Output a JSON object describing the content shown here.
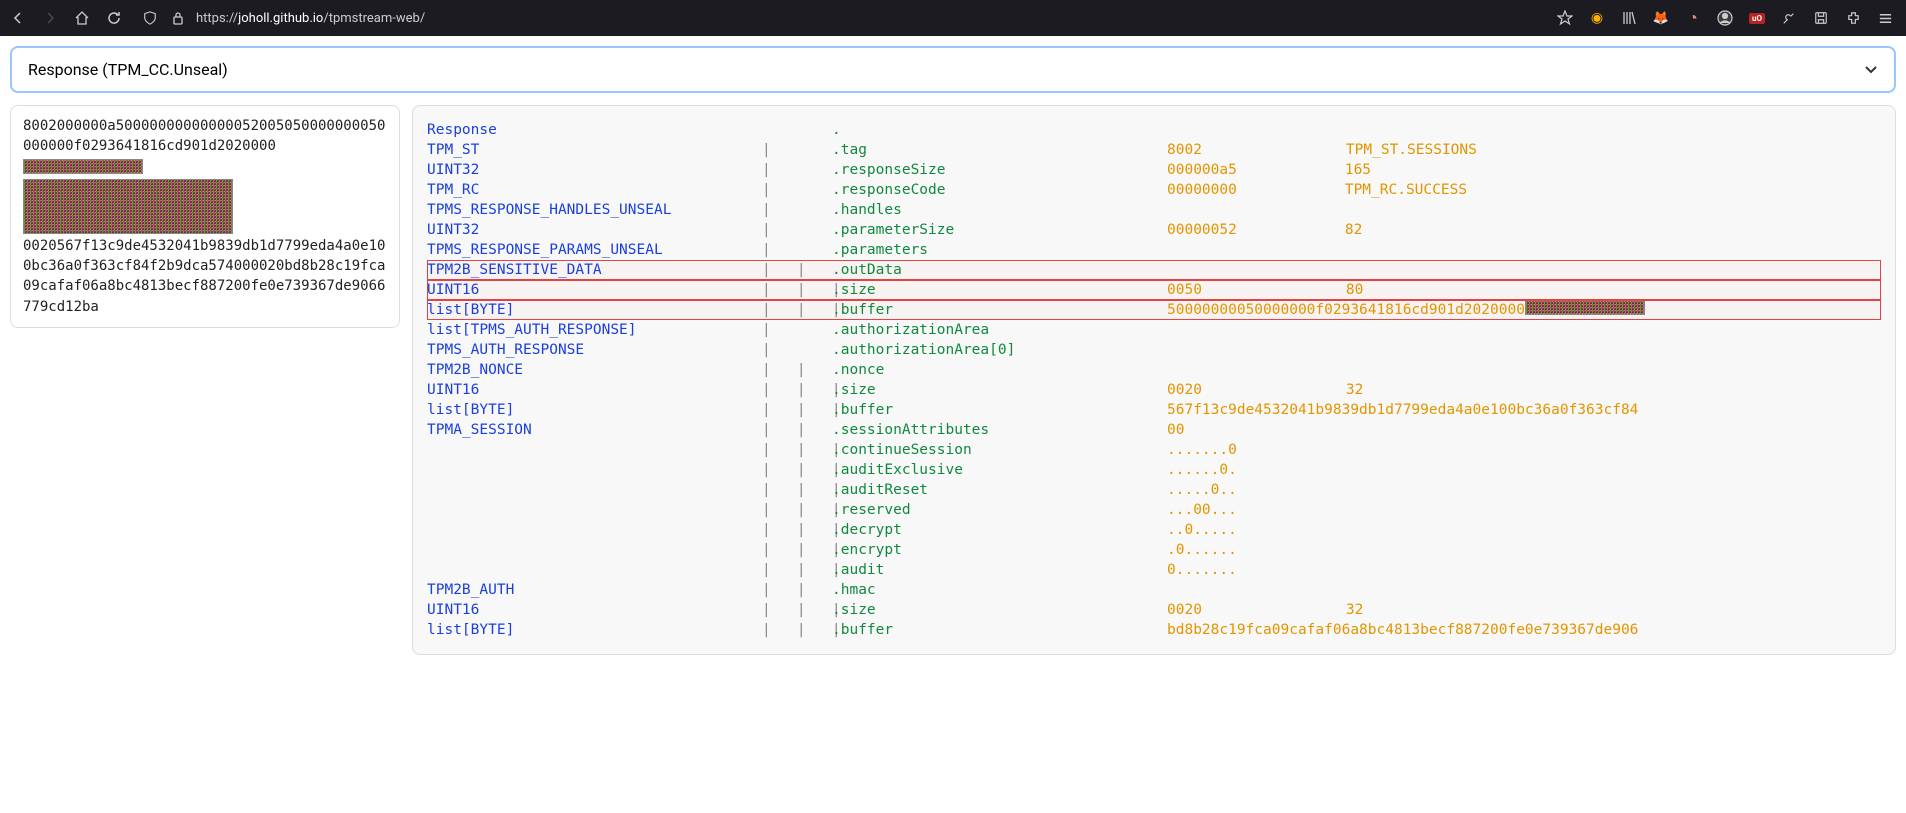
{
  "browser": {
    "url_prefix": "https://",
    "url_domain": "joholl.github.io",
    "url_path": "/tpmstream-web/",
    "ublock": "uO"
  },
  "dropdown": {
    "label": "Response (TPM_CC.Unseal)"
  },
  "hex": {
    "part1": "8002000000a50000000000000052005050000000050000",
    "part2": "000f0293641816cd901d2020000",
    "part3": "0020567f13c9de4532041b9839db1d7799eda4a0e100bc36a0f363cf84f2b9dca574000020bd8b28c19fca09cafaf06a8bc4813becf887200fe0e739367de9066779cd12ba"
  },
  "rows": [
    {
      "type": "Response",
      "pipe": "",
      "name": ".",
      "val": "",
      "desc": ""
    },
    {
      "type": "TPM_ST",
      "pipe": "|   ",
      "name": ".tag",
      "val": "8002",
      "desc": "TPM_ST.SESSIONS"
    },
    {
      "type": "UINT32",
      "pipe": "|   ",
      "name": ".responseSize",
      "val": "000000a5",
      "desc": "165"
    },
    {
      "type": "TPM_RC",
      "pipe": "|   ",
      "name": ".responseCode",
      "val": "00000000",
      "desc": "TPM_RC.SUCCESS"
    },
    {
      "type": "TPMS_RESPONSE_HANDLES_UNSEAL",
      "pipe": "|   ",
      "name": ".handles",
      "val": "",
      "desc": ""
    },
    {
      "type": "UINT32",
      "pipe": "|   ",
      "name": ".parameterSize",
      "val": "00000052",
      "desc": "82"
    },
    {
      "type": "TPMS_RESPONSE_PARAMS_UNSEAL",
      "pipe": "|   ",
      "name": ".parameters",
      "val": "",
      "desc": ""
    },
    {
      "type": "TPM2B_SENSITIVE_DATA",
      "pipe": "|   |   ",
      "name": ".outData",
      "val": "",
      "desc": "",
      "hl": true
    },
    {
      "type": "UINT16",
      "pipe": "|   |   |   ",
      "name": ".size",
      "val": "0050",
      "desc": "80",
      "hl": true
    },
    {
      "type": "list[BYTE]",
      "pipe": "|   |   |   ",
      "name": ".buffer",
      "val": "50000000050000000f0293641816cd901d2020000",
      "desc": "",
      "hl": true,
      "noise": true
    },
    {
      "type": "list[TPMS_AUTH_RESPONSE]",
      "pipe": "|   ",
      "name": ".authorizationArea",
      "val": "",
      "desc": ""
    },
    {
      "type": "TPMS_AUTH_RESPONSE",
      "pipe": "|   ",
      "name": ".authorizationArea[0]",
      "val": "",
      "desc": ""
    },
    {
      "type": "TPM2B_NONCE",
      "pipe": "|   |   ",
      "name": ".nonce",
      "val": "",
      "desc": ""
    },
    {
      "type": "UINT16",
      "pipe": "|   |   |   ",
      "name": ".size",
      "val": "0020",
      "desc": "32"
    },
    {
      "type": "list[BYTE]",
      "pipe": "|   |   |   ",
      "name": ".buffer",
      "val": "567f13c9de4532041b9839db1d7799eda4a0e100bc36a0f363cf84",
      "desc": ""
    },
    {
      "type": "TPMA_SESSION",
      "pipe": "|   |   ",
      "name": ".sessionAttributes",
      "val": "00",
      "desc": ""
    },
    {
      "type": "",
      "pipe": "|   |   |   ",
      "name": ".continueSession",
      "val": ".......0",
      "desc": ""
    },
    {
      "type": "",
      "pipe": "|   |   |   ",
      "name": ".auditExclusive",
      "val": "......0.",
      "desc": ""
    },
    {
      "type": "",
      "pipe": "|   |   |   ",
      "name": ".auditReset",
      "val": ".....0..",
      "desc": ""
    },
    {
      "type": "",
      "pipe": "|   |   |   ",
      "name": ".reserved",
      "val": "...00...",
      "desc": ""
    },
    {
      "type": "",
      "pipe": "|   |   |   ",
      "name": ".decrypt",
      "val": "..0.....",
      "desc": ""
    },
    {
      "type": "",
      "pipe": "|   |   |   ",
      "name": ".encrypt",
      "val": ".0......",
      "desc": ""
    },
    {
      "type": "",
      "pipe": "|   |   |   ",
      "name": ".audit",
      "val": "0.......",
      "desc": ""
    },
    {
      "type": "TPM2B_AUTH",
      "pipe": "|   |   ",
      "name": ".hmac",
      "val": "",
      "desc": ""
    },
    {
      "type": "UINT16",
      "pipe": "|   |   |   ",
      "name": ".size",
      "val": "0020",
      "desc": "32"
    },
    {
      "type": "list[BYTE]",
      "pipe": "|   |   |   ",
      "name": ".buffer",
      "val": "bd8b28c19fca09cafaf06a8bc4813becf887200fe0e739367de906",
      "desc": ""
    }
  ]
}
